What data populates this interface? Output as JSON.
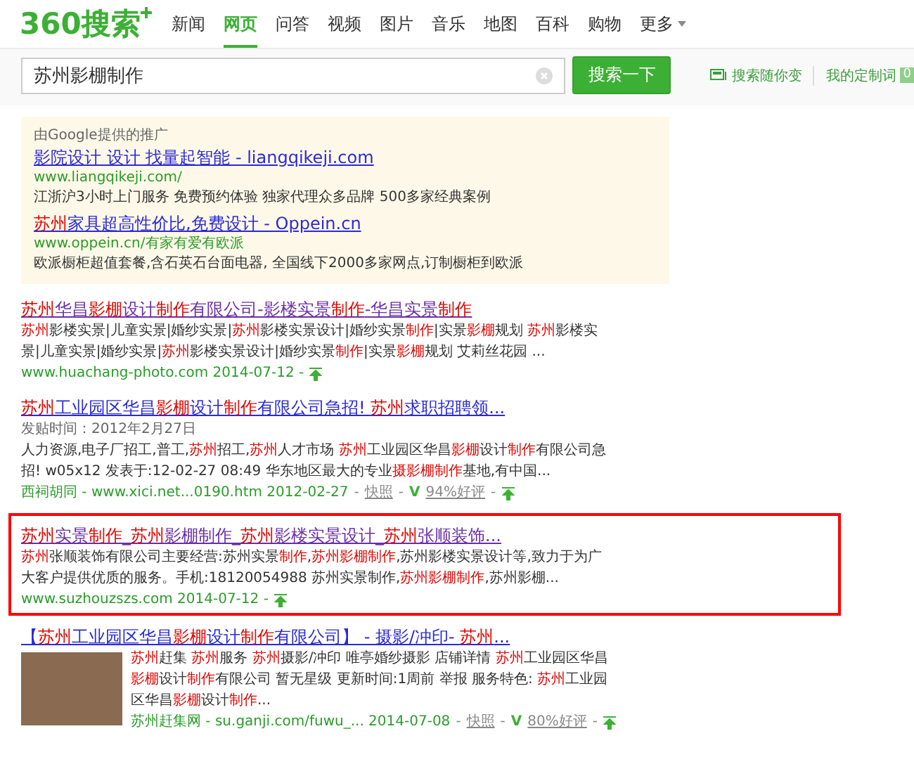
{
  "header": {
    "logo": "360搜索",
    "nav": [
      {
        "label": "新闻",
        "selected": false
      },
      {
        "label": "网页",
        "selected": true
      },
      {
        "label": "问答",
        "selected": false
      },
      {
        "label": "视频",
        "selected": false
      },
      {
        "label": "图片",
        "selected": false
      },
      {
        "label": "音乐",
        "selected": false
      },
      {
        "label": "地图",
        "selected": false
      },
      {
        "label": "百科",
        "selected": false
      },
      {
        "label": "购物",
        "selected": false
      },
      {
        "label": "更多",
        "selected": false
      }
    ]
  },
  "search": {
    "value": "苏州影棚制作",
    "button": "搜索一下",
    "links": [
      "搜索随你变",
      "我的定制词"
    ],
    "count": "0"
  },
  "ads": {
    "label": "由Google提供的推广",
    "items": [
      {
        "title": "影院设计 设计 找量起智能 - liangqikeji.com",
        "url": "www.liangqikeji.com/",
        "desc": "江浙沪3小时上门服务 免费预约体验 独家代理众多品牌 500多家经典案例"
      },
      {
        "title": "**苏州**家具超高性价比,免费设计 - Oppein.cn",
        "url": "www.oppein.cn/有家有爱有欧派",
        "desc": "欧派橱柜超值套餐,含石英石台面电器, 全国线下2000多家网点,订制橱柜到欧派"
      }
    ]
  },
  "results": [
    {
      "title": "**苏州**华昌**影棚**设计**制作**有限公司-影楼实景**制作**-华昌实景**制作**",
      "kind": "text",
      "visited": true,
      "highlighted": false,
      "desc": "**苏州**影楼实景|儿童实景|婚纱实景|**苏州**影楼实景设计|婚纱实景**制作**|实景**影棚**规划 **苏州**影楼实景|儿童实景|婚纱实景|**苏州**影楼实景设计|婚纱实景**制作**|实景**影棚**规划 艾莉丝花园 ...",
      "footer": [
        {
          "kind": "url",
          "text": "www.huachang-photo.com 2014-07-12 -"
        },
        {
          "kind": "arrow"
        }
      ]
    },
    {
      "title": "**苏州**工业园区华昌**影棚**设计**制作**有限公司急招! **苏州**求职招聘领...",
      "kind": "text",
      "visited": false,
      "highlighted": false,
      "date_line": "发贴时间：2012年2月27日",
      "desc": "人力资源,电子厂招工,普工,**苏州**招工,**苏州**人才市场 **苏州**工业园区华昌**影棚**设计**制作**有限公司急招! w05x12 发表于:12-02-27 08:49 华东地区最大的专业**摄影棚制作**基地,有中国...",
      "footer": [
        {
          "kind": "url",
          "text": "西祠胡同 - www.xici.net...0190.htm 2012-02-27"
        },
        {
          "kind": "sep",
          "text": "-"
        },
        {
          "kind": "link",
          "text": "快照"
        },
        {
          "kind": "sep",
          "text": "-"
        },
        {
          "kind": "v",
          "text": "V"
        },
        {
          "kind": "link",
          "text": "94%好评"
        },
        {
          "kind": "sep",
          "text": "-"
        },
        {
          "kind": "arrow"
        }
      ]
    },
    {
      "title": "**苏州**实景**制作**_**苏州**影棚制作_**苏州**影楼实景设计_**苏州**张顺装饰...",
      "kind": "text",
      "visited": true,
      "highlighted": true,
      "desc": "**苏州**张顺装饰有限公司主要经营:苏州实景**制作**,**苏州影棚制作**,苏州影楼实景设计等,致力于为广大客户提供优质的服务。手机:18120054988 苏州实景制作,**苏州影棚制作**,苏州影棚...",
      "footer": [
        {
          "kind": "url",
          "text": "www.suzhouzszs.com 2014-07-12 -"
        },
        {
          "kind": "arrow"
        }
      ]
    },
    {
      "title": "【**苏州**工业园区华昌**影棚**设计**制作**有限公司】 - 摄影/冲印- **苏州**...",
      "kind": "photo",
      "visited": false,
      "highlighted": false,
      "desc": "**苏州**赶集 **苏州**服务 **苏州**摄影/冲印 唯亭婚纱摄影 店铺详情 **苏州**工业园区华昌**影棚**设计**制作**有限公司 暂无星级 更新时间:1周前 举报 服务特色: **苏州**工业园区华昌**影棚**设计**制作**...",
      "footer": [
        {
          "kind": "url",
          "text": "苏州赶集网 - su.ganji.com/fuwu_... 2014-07-08"
        },
        {
          "kind": "sep",
          "text": "-"
        },
        {
          "kind": "link",
          "text": "快照"
        },
        {
          "kind": "sep",
          "text": "-"
        },
        {
          "kind": "v",
          "text": "V"
        },
        {
          "kind": "link",
          "text": "80%好评"
        },
        {
          "kind": "sep",
          "text": "-"
        },
        {
          "kind": "arrow"
        }
      ]
    }
  ]
}
